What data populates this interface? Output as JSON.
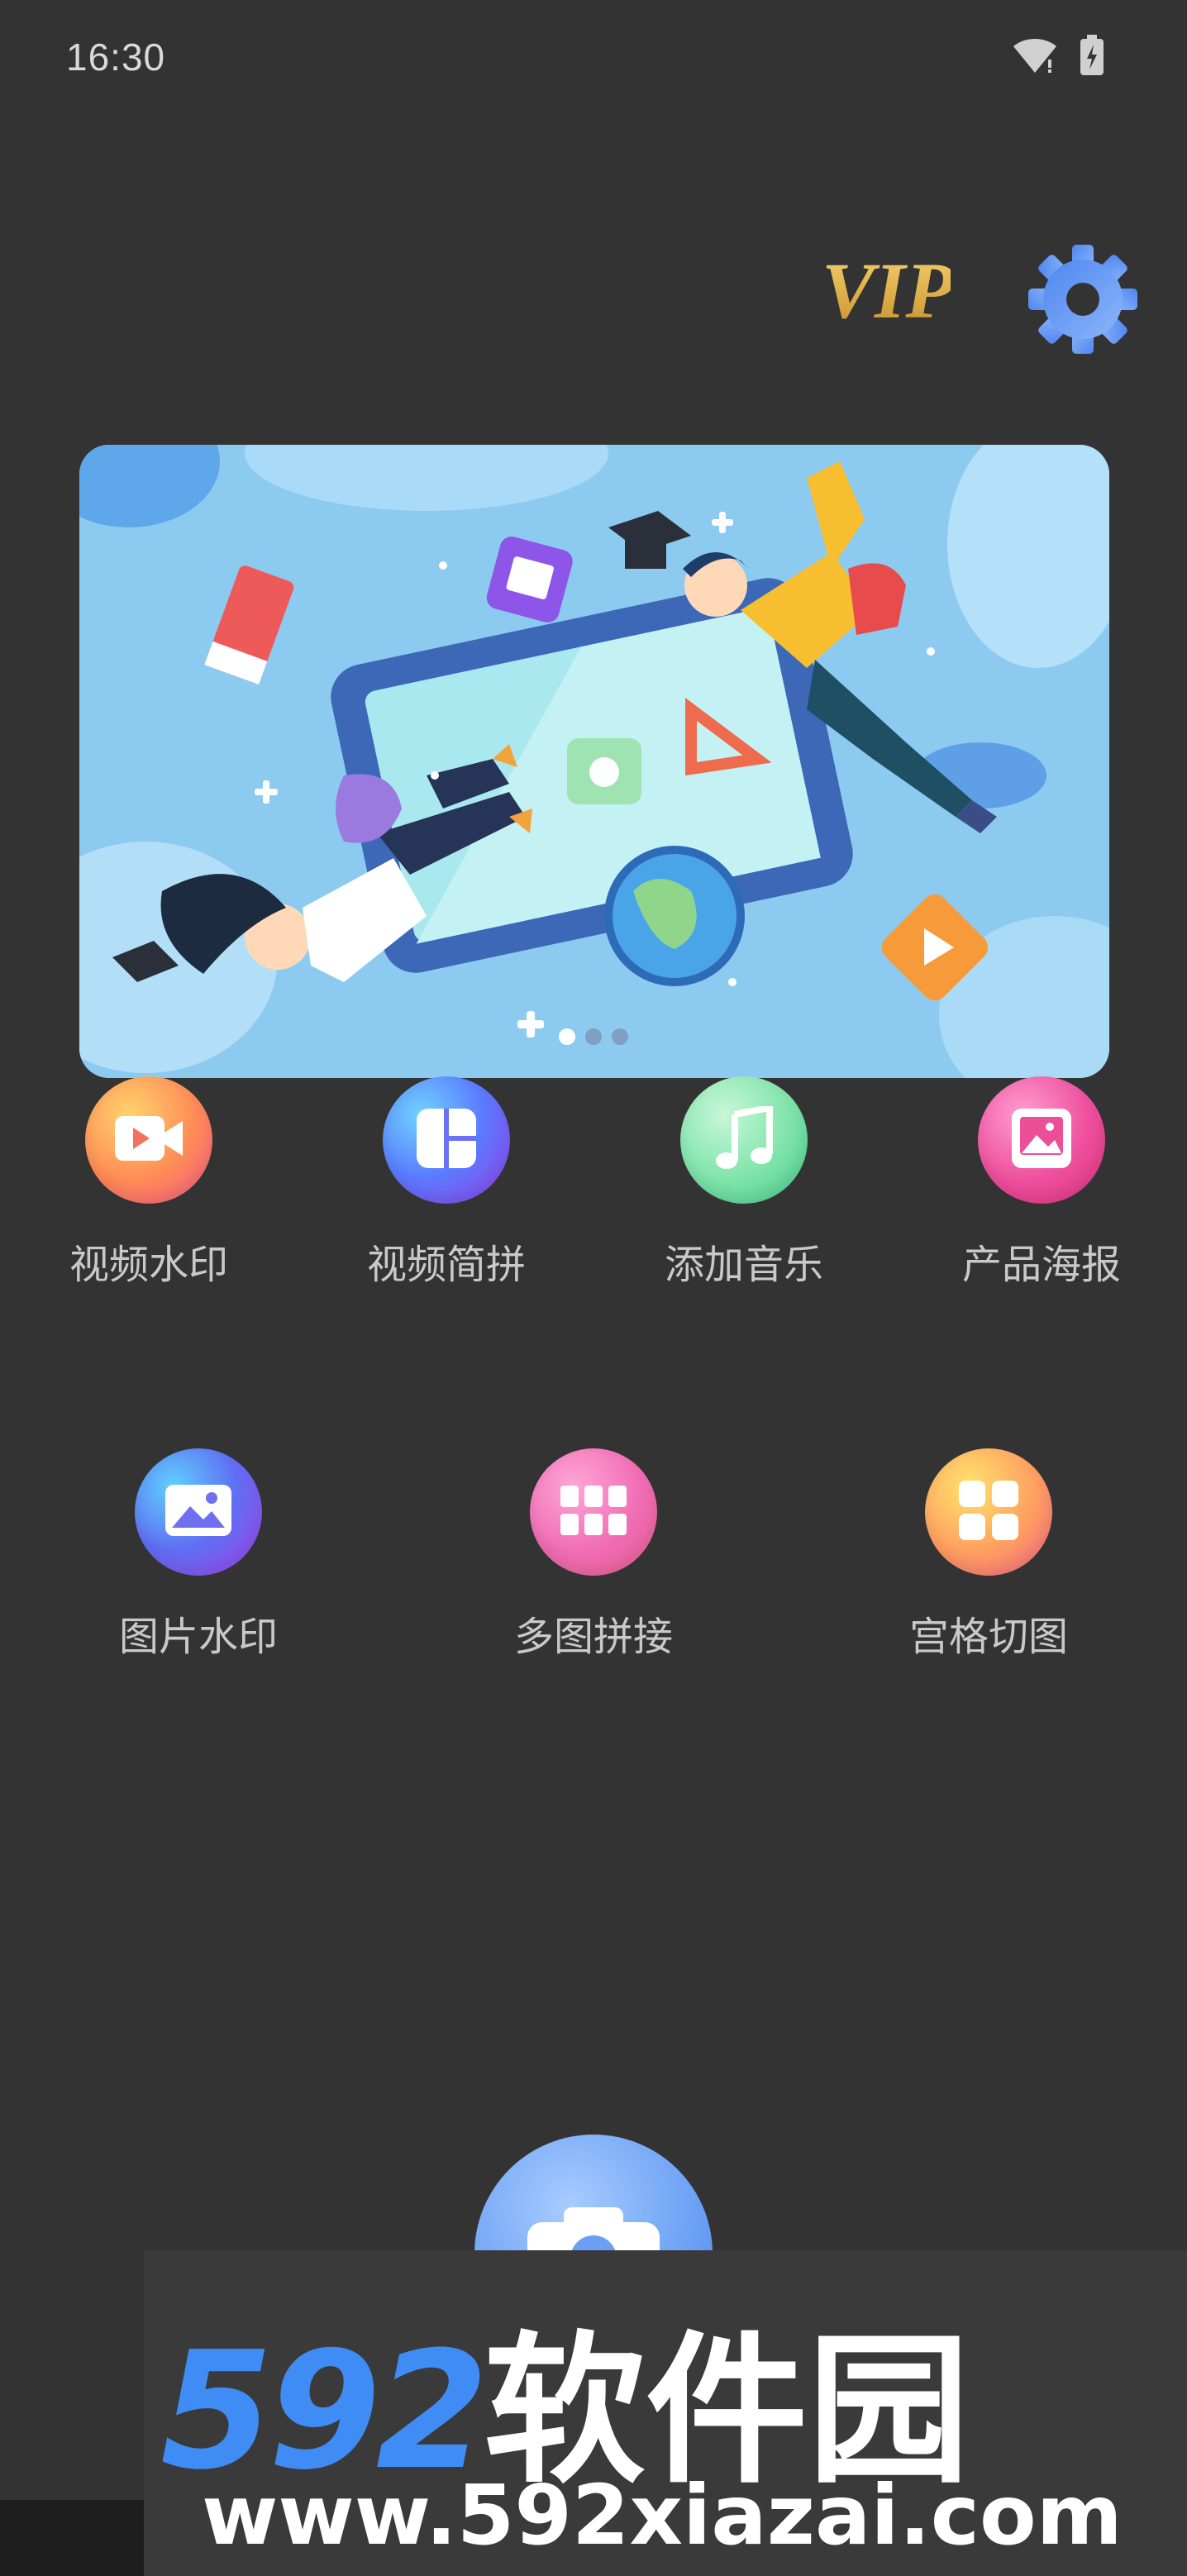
{
  "status_bar": {
    "time": "16:30"
  },
  "header": {
    "vip_label": "VIP"
  },
  "banner": {
    "slide_count": 3,
    "active_slide": 1
  },
  "features_row1": [
    {
      "label": "视频水印",
      "icon": "video-icon"
    },
    {
      "label": "视频简拼",
      "icon": "layout-icon"
    },
    {
      "label": "添加音乐",
      "icon": "music-note-icon"
    },
    {
      "label": "产品海报",
      "icon": "poster-icon"
    }
  ],
  "features_row2": [
    {
      "label": "图片水印",
      "icon": "image-icon"
    },
    {
      "label": "多图拼接",
      "icon": "grid-icon"
    },
    {
      "label": "宫格切图",
      "icon": "four-squares-icon"
    }
  ],
  "camera_fab": {
    "icon": "camera-icon"
  },
  "watermark": {
    "logo_num": "592",
    "logo_cn": "软件园",
    "url": "www.592xiazai.com"
  },
  "colors": {
    "background": "#333333",
    "vip_gold": "#e5b64a",
    "settings_blue": "#5b8ff1",
    "label_gray": "#c9c9c9"
  }
}
